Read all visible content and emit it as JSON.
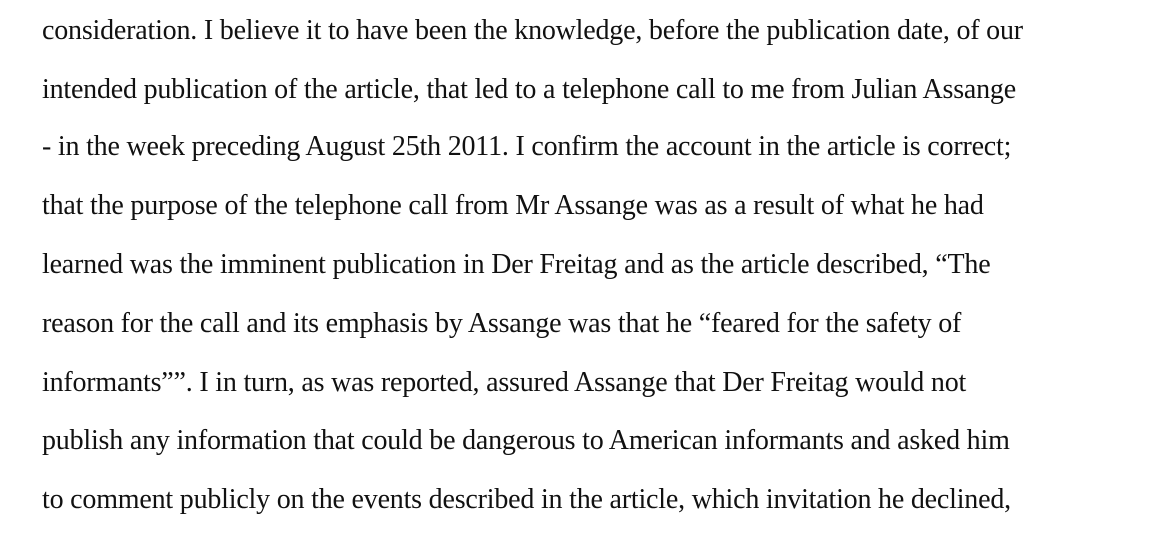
{
  "document": {
    "lines": [
      "consideration. I believe it to have been the knowledge, before the publication date, of our",
      "intended publication of the article, that led to a telephone call to me from Julian Assange",
      "- in the week preceding August 25th 2011. I confirm the account in the article is correct;",
      "that the purpose of the telephone call from Mr Assange was as a result of what he had",
      "learned was the imminent publication in Der Freitag and as the article described, “The",
      "reason for the call and its emphasis by Assange was that he “feared for the safety of",
      "informants””. I in turn, as was reported, assured Assange that Der Freitag would not",
      "publish any information that could be dangerous to American informants and asked him",
      "to comment publicly on the events described in the article, which invitation he declined,"
    ]
  }
}
